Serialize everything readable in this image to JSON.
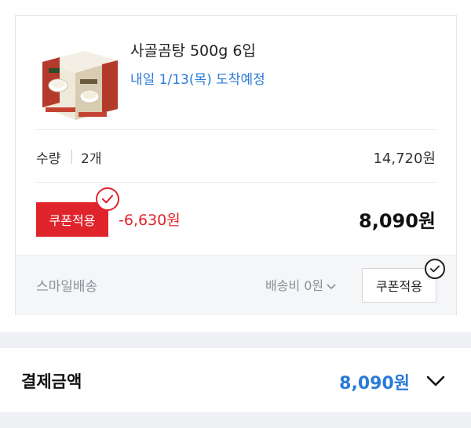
{
  "product": {
    "name": "사골곰탕 500g 6입",
    "delivery": "내일 1/13(목) 도착예정"
  },
  "quantity": {
    "label": "수량",
    "value": "2개",
    "price": "14,720원"
  },
  "coupon": {
    "button_label": "쿠폰적용",
    "discount": "-6,630원",
    "final_price": "8,090원"
  },
  "shipping": {
    "label": "스마일배송",
    "fee": "배송비 0원",
    "coupon_label": "쿠폰적용"
  },
  "payment": {
    "label": "결제금액",
    "amount": "8,090원"
  },
  "colors": {
    "accent_blue": "#2a7bd8",
    "coupon_red": "#e0242c"
  }
}
